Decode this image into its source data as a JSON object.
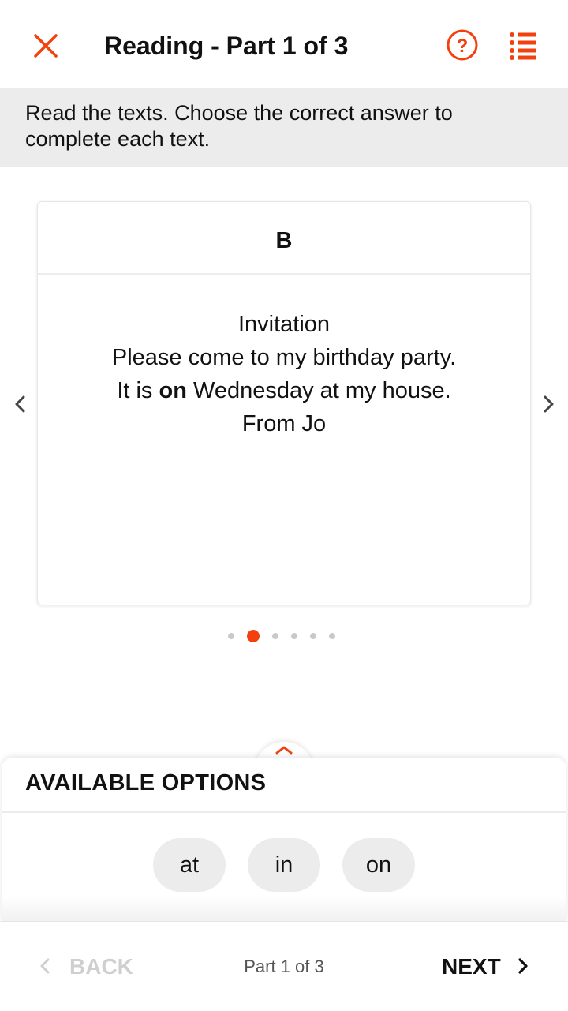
{
  "header": {
    "title": "Reading - Part 1 of 3",
    "close_icon": "close-icon",
    "help_icon": "help-circle-icon",
    "list_icon": "list-icon"
  },
  "instructions": "Read the texts. Choose the correct answer to complete each text.",
  "card": {
    "label": "B",
    "lines": [
      "Invitation",
      "Please come to my birthday party."
    ],
    "line3_before": "It is ",
    "line3_answer": "on",
    "line3_after": " Wednesday at my house.",
    "line4": "From Jo"
  },
  "pagination": {
    "total": 6,
    "active_index": 1
  },
  "options": {
    "title": "AVAILABLE OPTIONS",
    "items": [
      "at",
      "in",
      "on"
    ]
  },
  "footer": {
    "back_label": "BACK",
    "part_label": "Part 1 of 3",
    "next_label": "NEXT"
  },
  "colors": {
    "accent": "#f2400f",
    "panel_gray": "#ececec",
    "disabled": "#cfcfcf"
  }
}
